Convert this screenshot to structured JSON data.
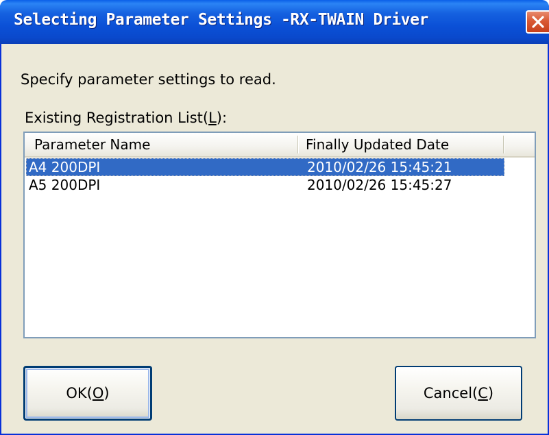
{
  "window": {
    "title": "Selecting Parameter Settings -RX-TWAIN Driver",
    "close_glyph": "✕"
  },
  "prompt": "Specify parameter settings to read.",
  "list": {
    "label_prefix": "Existing Registration List(",
    "label_mnemonic": "L",
    "label_suffix": "):",
    "columns": [
      "Parameter Name",
      "Finally Updated Date"
    ],
    "rows": [
      {
        "name": "A4 200DPI",
        "date": "2010/02/26 15:45:21",
        "selected": true
      },
      {
        "name": "A5 200DPI",
        "date": "2010/02/26 15:45:27",
        "selected": false
      }
    ]
  },
  "buttons": {
    "ok": {
      "prefix": "OK(",
      "mnemonic": "O",
      "suffix": ")"
    },
    "cancel": {
      "prefix": "Cancel(",
      "mnemonic": "C",
      "suffix": ")"
    }
  },
  "colors": {
    "titlebar": "#0a4fd4",
    "dialog_bg": "#ece9d8",
    "selection": "#316ac5",
    "close_button": "#d95a35"
  }
}
